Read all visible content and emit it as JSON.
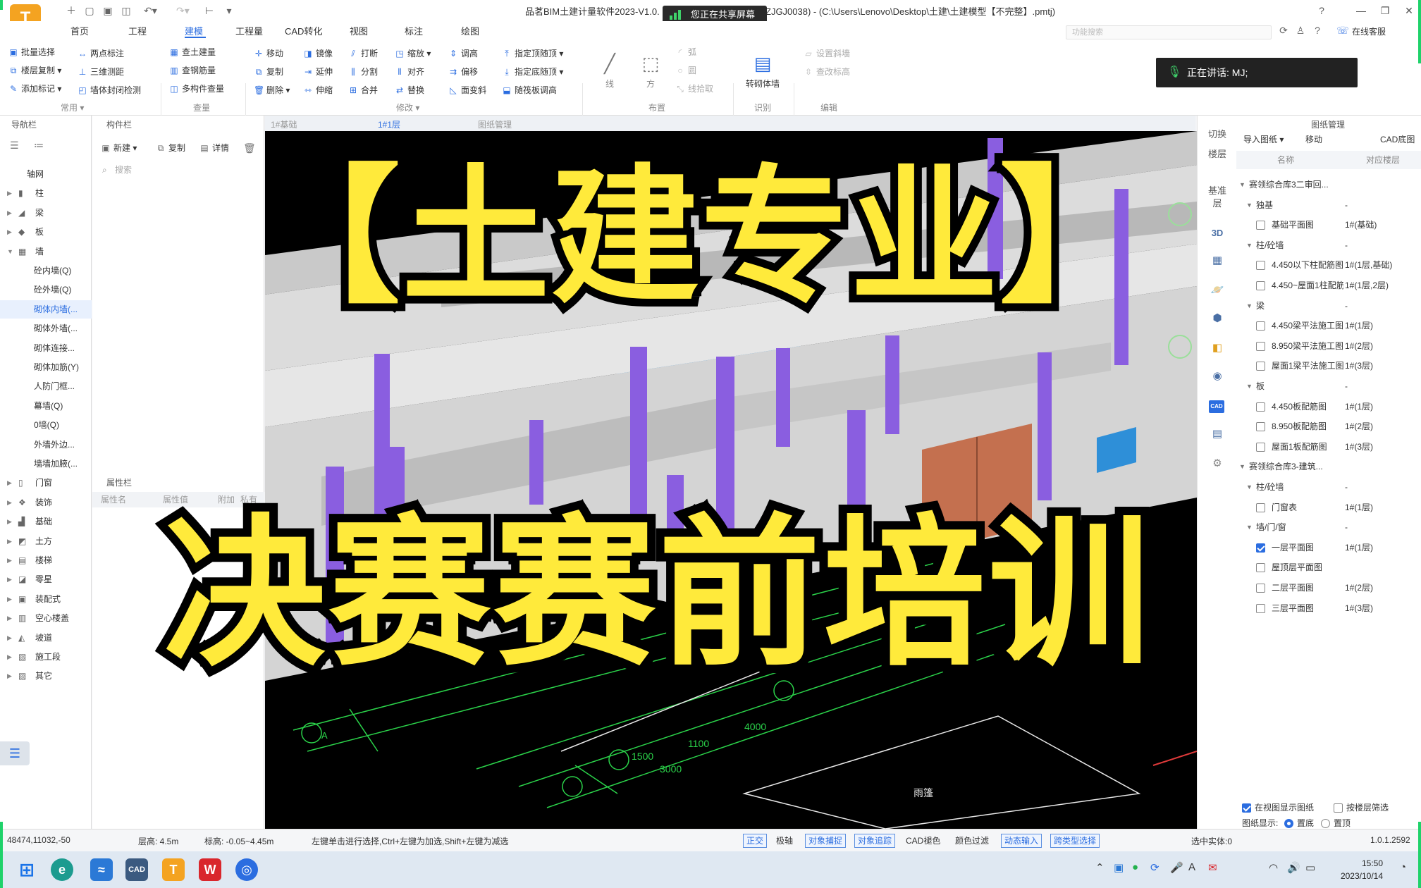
{
  "window": {
    "title_left": "品茗BIM土建计量软件2023-V1.0.",
    "title_right": "ZJGJ0038) - (C:\\Users\\Lenovo\\Desktop\\土建\\土建模型【不完整】.pmtj)",
    "share_banner": "您正在共享屏幕",
    "search_placeholder": "功能搜索",
    "online_service": "在线客服"
  },
  "menu": [
    "首页",
    "工程",
    "建模",
    "工程量",
    "CAD转化",
    "视图",
    "标注",
    "绘图"
  ],
  "menu_active": "建模",
  "ribbon": {
    "common": [
      "批量选择",
      "楼层复制",
      "添加标记",
      "两点标注",
      "三维测距",
      "墙体封闭检测"
    ],
    "common_group": "常用",
    "query": [
      "查土建量",
      "查钢筋量",
      "多构件查量"
    ],
    "query_group": "查量",
    "modify": [
      "移动",
      "复制",
      "删除",
      "镜像",
      "延伸",
      "伸缩",
      "打断",
      "分割",
      "合并",
      "缩放",
      "对齐",
      "替换",
      "调高",
      "偏移",
      "面变斜",
      "指定顶随顶",
      "指定底随顶",
      "随筏板调高"
    ],
    "modify_group": "修改",
    "layout": [
      "线",
      "方",
      "弧",
      "圆",
      "线拾取"
    ],
    "layout_group": "布置",
    "identify": [
      "转砌体墙"
    ],
    "identify_group": "识别",
    "edit": [
      "设置斜墙",
      "查改标高"
    ],
    "edit_group": "编辑"
  },
  "speech_bar": "正在讲话:  MJ;",
  "nav": {
    "title": "导航栏",
    "items": [
      {
        "label": "轴网",
        "icon": "",
        "arrow": ""
      },
      {
        "label": "柱",
        "icon": "▮",
        "arrow": "▶"
      },
      {
        "label": "梁",
        "icon": "◢",
        "arrow": "▶"
      },
      {
        "label": "板",
        "icon": "◆",
        "arrow": "▶"
      },
      {
        "label": "墙",
        "icon": "▦",
        "arrow": "▼"
      },
      {
        "label": "砼内墙(Q)",
        "sub": true
      },
      {
        "label": "砼外墙(Q)",
        "sub": true
      },
      {
        "label": "砌体内墙(...",
        "sub": true,
        "active": true
      },
      {
        "label": "砌体外墙(...",
        "sub": true
      },
      {
        "label": "砌体连接...",
        "sub": true
      },
      {
        "label": "砌体加筋(Y)",
        "sub": true
      },
      {
        "label": "人防门框...",
        "sub": true
      },
      {
        "label": "幕墙(Q)",
        "sub": true
      },
      {
        "label": "0墙(Q)",
        "sub": true
      },
      {
        "label": "外墙外边...",
        "sub": true
      },
      {
        "label": "墙墙加腋(...",
        "sub": true
      },
      {
        "label": "门窗",
        "icon": "▯",
        "arrow": "▶"
      },
      {
        "label": "装饰",
        "icon": "❖",
        "arrow": "▶"
      },
      {
        "label": "基础",
        "icon": "▟",
        "arrow": "▶"
      },
      {
        "label": "土方",
        "icon": "◩",
        "arrow": "▶"
      },
      {
        "label": "楼梯",
        "icon": "▤",
        "arrow": "▶"
      },
      {
        "label": "零星",
        "icon": "◪",
        "arrow": "▶"
      },
      {
        "label": "装配式",
        "icon": "▣",
        "arrow": "▶"
      },
      {
        "label": "空心楼盖",
        "icon": "▥",
        "arrow": "▶"
      },
      {
        "label": "坡道",
        "icon": "◭",
        "arrow": "▶"
      },
      {
        "label": "施工段",
        "icon": "▧",
        "arrow": "▶"
      },
      {
        "label": "其它",
        "icon": "▨",
        "arrow": "▶"
      }
    ]
  },
  "components": {
    "title": "构件栏",
    "new": "新建",
    "copy": "复制",
    "detail": "详情",
    "search_placeholder": "搜索"
  },
  "properties": {
    "title": "属性栏",
    "cols": [
      "属性名",
      "属性值",
      "附加",
      "私有"
    ]
  },
  "canvas_tabs": [
    "1#基础",
    "1#1层",
    "图纸管理"
  ],
  "canvas_tab_active": "1#1层",
  "overlay": {
    "line1": "【土建专业】",
    "line2": "决赛赛前培训"
  },
  "view_toolbar": {
    "switch": "切换",
    "floor": "楼层",
    "base": "基准",
    "layer": "层",
    "three_d": "3D",
    "cad_badge": "CAD"
  },
  "drawings": {
    "title": "图纸管理",
    "import": "导入图纸",
    "move": "移动",
    "cad_base": "CAD底图",
    "col_name": "名称",
    "col_floor": "对应楼层",
    "rows": [
      {
        "level": 0,
        "toggle": "▼",
        "name": "赛领综合库3二审回...",
        "floor": ""
      },
      {
        "level": 1,
        "toggle": "▼",
        "name": "独基",
        "floor": "-"
      },
      {
        "level": 2,
        "checked": false,
        "name": "基础平面图",
        "floor": "1#(基础)"
      },
      {
        "level": 1,
        "toggle": "▼",
        "name": "柱/砼墙",
        "floor": "-"
      },
      {
        "level": 2,
        "checked": false,
        "name": "4.450以下柱配筋图",
        "floor": "1#(1层,基础)"
      },
      {
        "level": 2,
        "checked": false,
        "name": "4.450~屋面1柱配筋",
        "floor": "1#(1层,2层)"
      },
      {
        "level": 1,
        "toggle": "▼",
        "name": "梁",
        "floor": "-"
      },
      {
        "level": 2,
        "checked": false,
        "name": "4.450梁平法施工图",
        "floor": "1#(1层)"
      },
      {
        "level": 2,
        "checked": false,
        "name": "8.950梁平法施工图",
        "floor": "1#(2层)"
      },
      {
        "level": 2,
        "checked": false,
        "name": "屋面1梁平法施工图",
        "floor": "1#(3层)"
      },
      {
        "level": 1,
        "toggle": "▼",
        "name": "板",
        "floor": "-"
      },
      {
        "level": 2,
        "checked": false,
        "name": "4.450板配筋图",
        "floor": "1#(1层)"
      },
      {
        "level": 2,
        "checked": false,
        "name": "8.950板配筋图",
        "floor": "1#(2层)"
      },
      {
        "level": 2,
        "checked": false,
        "name": "屋面1板配筋图",
        "floor": "1#(3层)"
      },
      {
        "level": 0,
        "toggle": "▼",
        "name": "赛领综合库3-建筑...",
        "floor": ""
      },
      {
        "level": 1,
        "toggle": "▼",
        "name": "柱/砼墙",
        "floor": "-"
      },
      {
        "level": 2,
        "checked": false,
        "name": "门窗表",
        "floor": "1#(1层)"
      },
      {
        "level": 1,
        "toggle": "▼",
        "name": "墙/门/窗",
        "floor": "-"
      },
      {
        "level": 2,
        "checked": true,
        "name": "一层平面图",
        "floor": "1#(1层)"
      },
      {
        "level": 2,
        "checked": false,
        "name": "屋顶层平面图",
        "floor": ""
      },
      {
        "level": 2,
        "checked": false,
        "name": "二层平面图",
        "floor": "1#(2层)"
      },
      {
        "level": 2,
        "checked": false,
        "name": "三层平面图",
        "floor": "1#(3层)"
      }
    ],
    "show_in_view": "在视图显示图纸",
    "filter_by_floor": "按楼层筛选",
    "display_label": "图纸显示:",
    "bottom": "置底",
    "top": "置顶"
  },
  "status": {
    "coords": "48474,11032,-50",
    "floor_height": "层高:  4.5m",
    "elevation": "标高:  -0.05~4.45m",
    "hint": "左键单击进行选择,Ctrl+左键为加选,Shift+左键为减选",
    "buttons": [
      {
        "label": "正交",
        "on": true
      },
      {
        "label": "极轴",
        "on": false
      },
      {
        "label": "对象捕捉",
        "on": true
      },
      {
        "label": "对象追踪",
        "on": true
      },
      {
        "label": "CAD褪色",
        "on": false
      },
      {
        "label": "颜色过滤",
        "on": false
      },
      {
        "label": "动态输入",
        "on": true
      },
      {
        "label": "跨类型选择",
        "on": true
      }
    ],
    "selected": "选中实体:0",
    "version": "1.0.1.2592"
  },
  "taskbar": {
    "time": "15:50",
    "date": "2023/10/14"
  },
  "colors": {
    "accent": "#2b6de0",
    "title_yellow": "#ffea3b",
    "column_purple": "#8a5ee0",
    "door_orange": "#c4704f",
    "window_blue": "#2e8fd8",
    "cad_green": "#2bd34a"
  }
}
